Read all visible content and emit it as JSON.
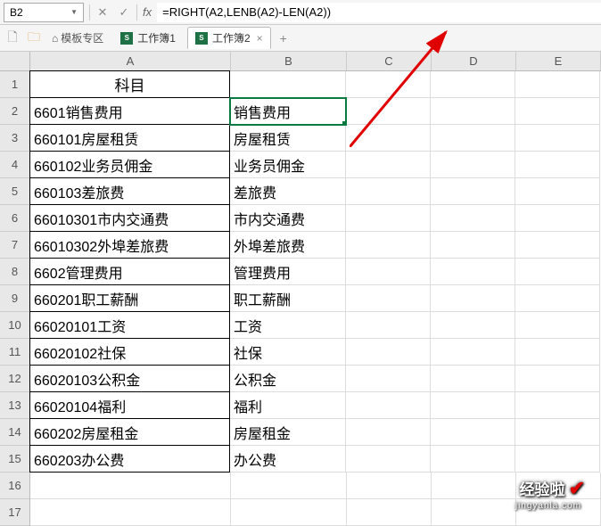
{
  "formula_bar": {
    "name_box": "B2",
    "formula": "=RIGHT(A2,LENB(A2)-LEN(A2))",
    "fx_label": "fx"
  },
  "tabs": {
    "template_area": "模板专区",
    "workbook1": "工作簿1",
    "workbook2": "工作簿2"
  },
  "columns": [
    "A",
    "B",
    "C",
    "D",
    "E"
  ],
  "rows_shown": [
    1,
    2,
    3,
    4,
    5,
    6,
    7,
    8,
    9,
    10,
    11,
    12,
    13,
    14,
    15,
    16,
    17
  ],
  "grid": {
    "A1": "科目",
    "A2": "6601销售费用",
    "B2": "销售费用",
    "A3": "660101房屋租赁",
    "B3": "房屋租赁",
    "A4": "660102业务员佣金",
    "B4": "业务员佣金",
    "A5": "660103差旅费",
    "B5": "差旅费",
    "A6": "66010301市内交通费",
    "B6": "市内交通费",
    "A7": "66010302外埠差旅费",
    "B7": "外埠差旅费",
    "A8": "6602管理费用",
    "B8": "管理费用",
    "A9": "660201职工薪酬",
    "B9": "职工薪酬",
    "A10": "66020101工资",
    "B10": "工资",
    "A11": "66020102社保",
    "B11": "社保",
    "A12": "66020103公积金",
    "B12": "公积金",
    "A13": "66020104福利",
    "B13": "福利",
    "A14": "660202房屋租金",
    "B14": "房屋租金",
    "A15": "660203办公费",
    "B15": "办公费"
  },
  "watermark": {
    "main": "经验啦",
    "sub": "jingyanla.com"
  }
}
